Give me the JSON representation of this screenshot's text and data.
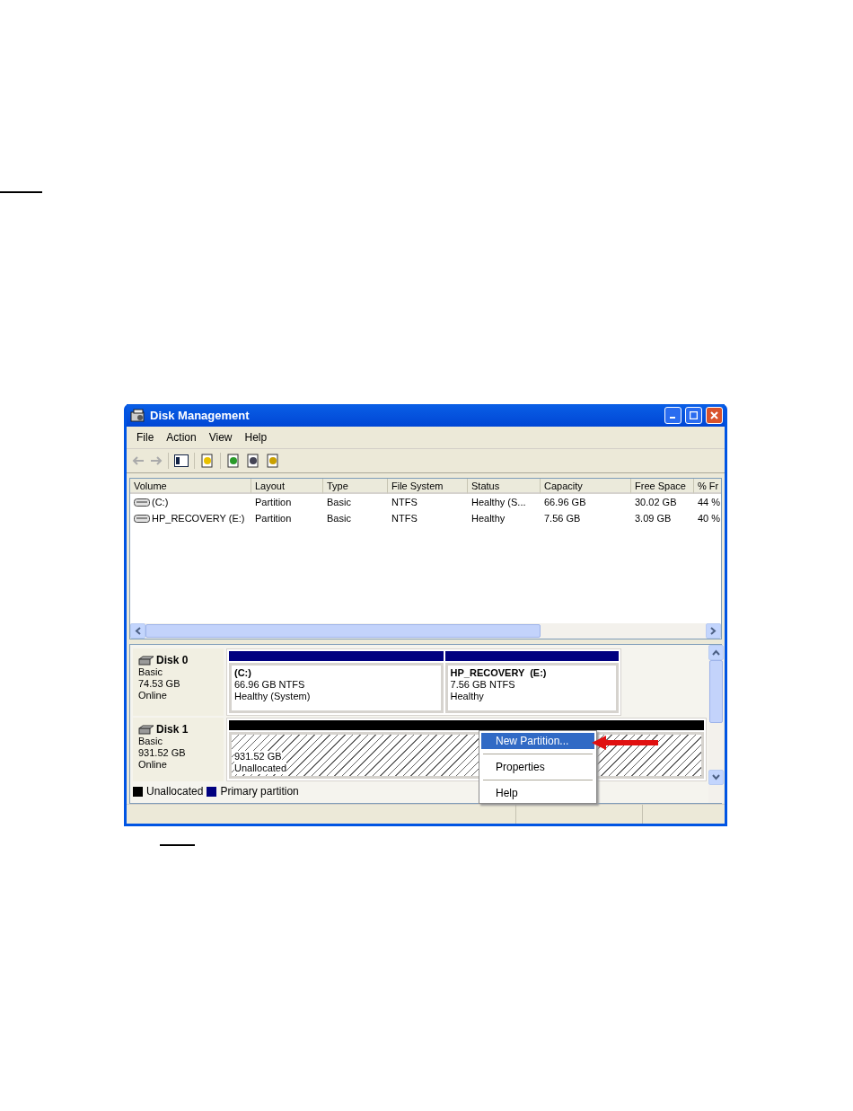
{
  "window": {
    "title": "Disk Management"
  },
  "menu": [
    "File",
    "Action",
    "View",
    "Help"
  ],
  "table": {
    "columns": [
      "Volume",
      "Layout",
      "Type",
      "File System",
      "Status",
      "Capacity",
      "Free Space",
      "% Fr"
    ],
    "rows": [
      [
        "(C:)",
        "Partition",
        "Basic",
        "NTFS",
        "Healthy (S...",
        "66.96 GB",
        "30.02 GB",
        "44 %"
      ],
      [
        "HP_RECOVERY (E:)",
        "Partition",
        "Basic",
        "NTFS",
        "Healthy",
        "7.56 GB",
        "3.09 GB",
        "40 %"
      ]
    ]
  },
  "disks": [
    {
      "name": "Disk 0",
      "type": "Basic",
      "size": "74.53 GB",
      "status": "Online",
      "partitions": [
        {
          "kind": "primary",
          "label": "(C:)",
          "size": "66.96 GB NTFS",
          "status": "Healthy (System)"
        },
        {
          "kind": "primary",
          "label": "HP_RECOVERY  (E:)",
          "size": "7.56 GB NTFS",
          "status": "Healthy"
        }
      ]
    },
    {
      "name": "Disk 1",
      "type": "Basic",
      "size": "931.52 GB",
      "status": "Online",
      "partitions": [
        {
          "kind": "unallocated",
          "size": "931.52 GB",
          "status": "Unallocated"
        }
      ]
    }
  ],
  "legend": [
    {
      "label": "Unallocated",
      "color": "#000000"
    },
    {
      "label": "Primary partition",
      "color": "#000080"
    }
  ],
  "context_menu": [
    {
      "label": "New Partition...",
      "selected": true
    },
    {
      "label": "Properties",
      "selected": false
    },
    {
      "label": "Help",
      "selected": false
    }
  ]
}
